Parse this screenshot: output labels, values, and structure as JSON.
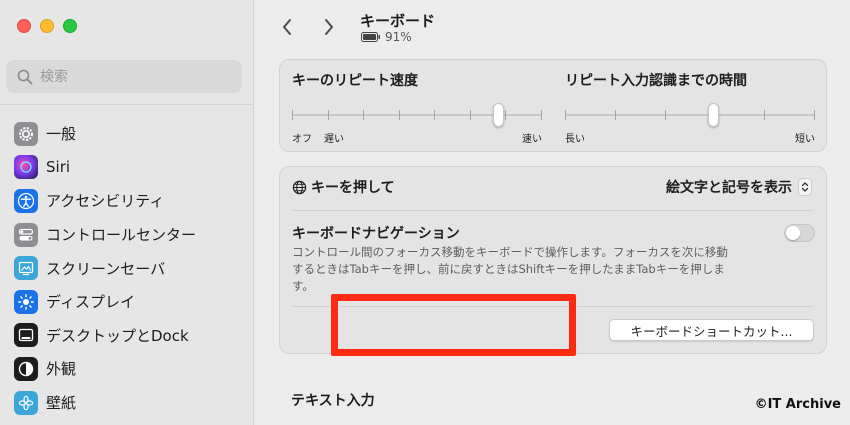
{
  "window": {
    "buttons": [
      "close",
      "minimize",
      "zoom"
    ]
  },
  "search": {
    "placeholder": "検索"
  },
  "sidebar": {
    "items": [
      {
        "label": "一般",
        "icon": "gear-icon",
        "color": "#8e8e93"
      },
      {
        "label": "Siri",
        "icon": "siri-icon",
        "color": "#5b2ea6"
      },
      {
        "label": "アクセシビリティ",
        "icon": "accessibility-icon",
        "color": "#1a73e8"
      },
      {
        "label": "コントロールセンター",
        "icon": "control-center-icon",
        "color": "#8e8e93"
      },
      {
        "label": "スクリーンセーバ",
        "icon": "screensaver-icon",
        "color": "#3aa7d8"
      },
      {
        "label": "ディスプレイ",
        "icon": "display-icon",
        "color": "#1a73e8"
      },
      {
        "label": "デスクトップとDock",
        "icon": "dock-icon",
        "color": "#1d1d1f"
      },
      {
        "label": "外観",
        "icon": "appearance-icon",
        "color": "#1d1d1f"
      },
      {
        "label": "壁紙",
        "icon": "wallpaper-icon",
        "color": "#3aa7d8"
      }
    ]
  },
  "header": {
    "title": "キーボード",
    "battery": "91%"
  },
  "key_repeat": {
    "title": "キーのリピート速度",
    "labels": [
      "オフ",
      "遅い",
      "速い"
    ],
    "level": 0.84
  },
  "repeat_delay": {
    "title": "リピート入力認識までの時間",
    "labels": [
      "長い",
      "短い"
    ],
    "level": 0.6
  },
  "globe_key": {
    "label": "キーを押して",
    "value": "絵文字と記号を表示"
  },
  "keyboard_navigation": {
    "title": "キーボードナビゲーション",
    "description": "コントロール間のフォーカス移動をキーボードで操作します。フォーカスを次に移動するときはTabキーを押し、前に戻すときはShiftキーを押したままTabキーを押します。",
    "enabled": false
  },
  "shortcut_button": "キーボードショートカット...",
  "text_input": {
    "title": "テキスト入力"
  },
  "watermark": "©IT Archive",
  "colors": {
    "highlight": "#ff2a12",
    "accent": "#1a73e8"
  }
}
